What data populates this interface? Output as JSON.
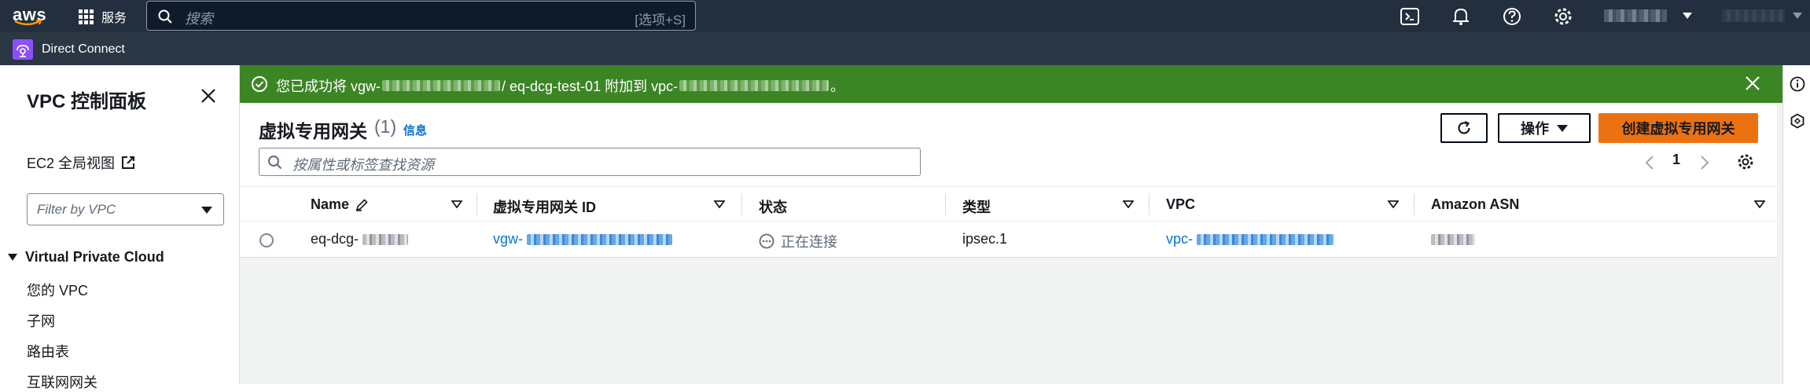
{
  "topnav": {
    "logo_text": "aws",
    "services_label": "服务",
    "search_placeholder": "搜索",
    "search_shortcut": "[选项+S]",
    "account_name": "",
    "region_name": ""
  },
  "service_bar": {
    "label": "Direct Connect"
  },
  "sidenav": {
    "title": "VPC 控制面板",
    "ec2_link": "EC2 全局视图",
    "filter_placeholder": "Filter by VPC",
    "section": "Virtual Private Cloud",
    "items": [
      "您的 VPC",
      "子网",
      "路由表",
      "互联网网关"
    ]
  },
  "flash": {
    "prefix": "您已成功将 vgw-",
    "middle": " / eq-dcg-test-01 附加到 vpc-",
    "suffix": "。",
    "status": "success"
  },
  "panel": {
    "title": "虚拟专用网关",
    "count": "(1)",
    "info_link": "信息",
    "actions_label": "操作",
    "create_label": "创建虚拟专用网关",
    "search_placeholder": "按属性或标签查找资源",
    "page": "1"
  },
  "table": {
    "columns": [
      "Name",
      "虚拟专用网关 ID",
      "状态",
      "类型",
      "VPC",
      "Amazon ASN"
    ],
    "rows": [
      {
        "name": "eq-dcg-",
        "id": "vgw-",
        "state": "正在连接",
        "type": "ipsec.1",
        "vpc": "vpc-",
        "asn": ""
      }
    ]
  },
  "colors": {
    "topnav_bg": "#232f3e",
    "flash_success": "#3c8525",
    "primary": "#ec7211",
    "link": "#0972d3"
  }
}
